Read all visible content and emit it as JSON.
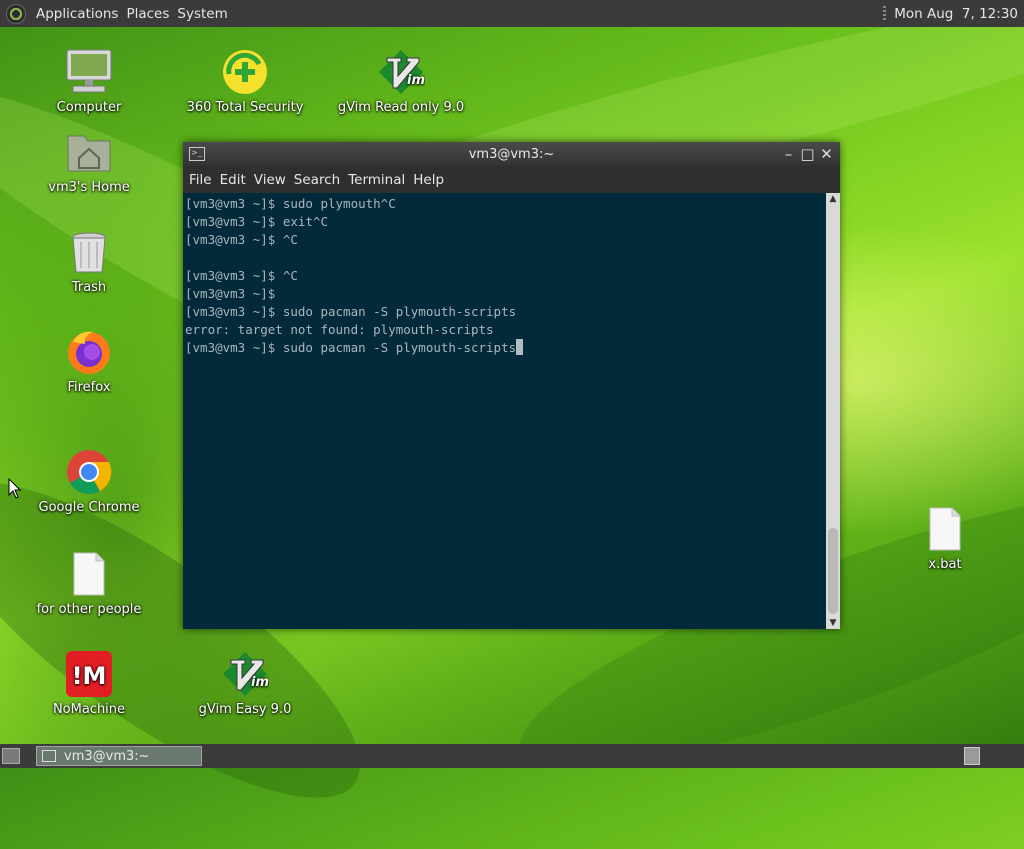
{
  "top_panel": {
    "menus": [
      "Applications",
      "Places",
      "System"
    ],
    "clock": "Mon Aug  7, 12:30"
  },
  "desktop_icons": [
    {
      "label": "Computer",
      "icon": "computer-icon"
    },
    {
      "label": "vm3's Home",
      "icon": "home-folder-icon"
    },
    {
      "label": "Trash",
      "icon": "trash-icon"
    },
    {
      "label": "Firefox",
      "icon": "firefox-icon"
    },
    {
      "label": "Google Chrome",
      "icon": "chrome-icon"
    },
    {
      "label": "for other people",
      "icon": "document-icon"
    },
    {
      "label": "NoMachine",
      "icon": "nomachine-icon"
    },
    {
      "label": "360 Total Security",
      "icon": "360-security-icon"
    },
    {
      "label": "gVim Read only 9.0",
      "icon": "gvim-icon"
    },
    {
      "label": "gVim Easy 9.0",
      "icon": "gvim-icon"
    },
    {
      "label": "x.bat",
      "icon": "document-icon"
    }
  ],
  "terminal": {
    "title": "vm3@vm3:~",
    "menu": [
      "File",
      "Edit",
      "View",
      "Search",
      "Terminal",
      "Help"
    ],
    "lines": [
      "[vm3@vm3 ~]$ sudo plymouth^C",
      "[vm3@vm3 ~]$ exit^C",
      "[vm3@vm3 ~]$ ^C",
      "",
      "[vm3@vm3 ~]$ ^C",
      "[vm3@vm3 ~]$",
      "[vm3@vm3 ~]$ sudo pacman -S plymouth-scripts",
      "error: target not found: plymouth-scripts",
      "[vm3@vm3 ~]$ sudo pacman -S plymouth-scripts"
    ]
  },
  "taskbar": {
    "task_label": "vm3@vm3:~"
  },
  "colors": {
    "terminal_bg": "#022a3a",
    "terminal_fg": "#a9b6bd",
    "panel_bg": "#3b3b3b"
  }
}
